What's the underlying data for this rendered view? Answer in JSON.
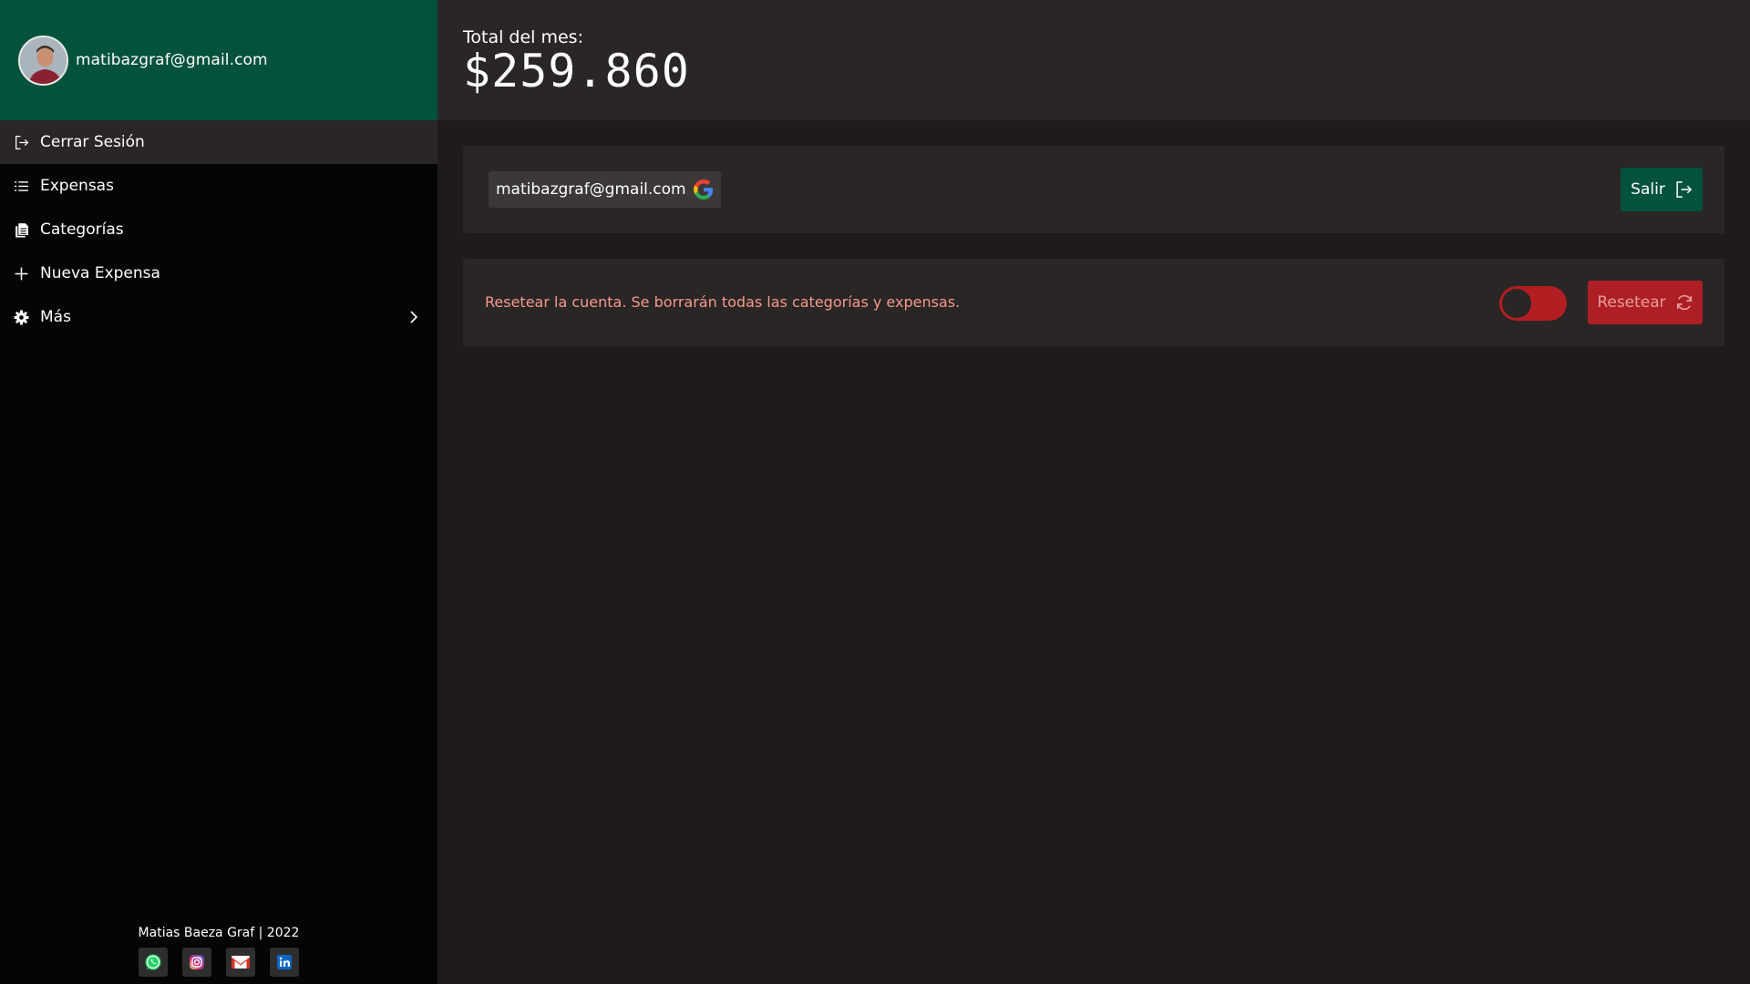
{
  "sidebar": {
    "user_email": "matibazgraf@gmail.com",
    "avatar_icon": "user-avatar",
    "items": [
      {
        "label": "Cerrar Sesión",
        "icon": "logout-icon",
        "active": true
      },
      {
        "label": "Expensas",
        "icon": "list-icon",
        "active": false
      },
      {
        "label": "Categorías",
        "icon": "files-icon",
        "active": false
      },
      {
        "label": "Nueva Expensa",
        "icon": "plus-icon",
        "active": false
      },
      {
        "label": "Más",
        "icon": "gear-icon",
        "active": false,
        "has_chevron": true
      }
    ],
    "footer": {
      "credit": "Matias Baeza Graf | 2022",
      "social": [
        {
          "icon": "whatsapp-icon",
          "color": "#25d366"
        },
        {
          "icon": "instagram-icon",
          "color": "#e1306c"
        },
        {
          "icon": "gmail-icon",
          "color": "#d93025"
        },
        {
          "icon": "linkedin-icon",
          "color": "#0a66c2"
        }
      ]
    }
  },
  "header": {
    "total_label": "Total del mes:",
    "total_value": "$259.860"
  },
  "account_card": {
    "email": "matibazgraf@gmail.com",
    "provider_icon": "google-icon",
    "logout_label": "Salir"
  },
  "reset_card": {
    "warning_text": "Resetear la cuenta. Se borrarán todas las categorías y expensas.",
    "toggle_on": false,
    "reset_label": "Resetear"
  },
  "colors": {
    "primary_green": "#02523c",
    "danger_red": "#ad1f24",
    "warning_text": "#f59a8e",
    "panel": "#2a2625",
    "background": "#1f1b1a",
    "sidebar_bg": "#050505"
  }
}
